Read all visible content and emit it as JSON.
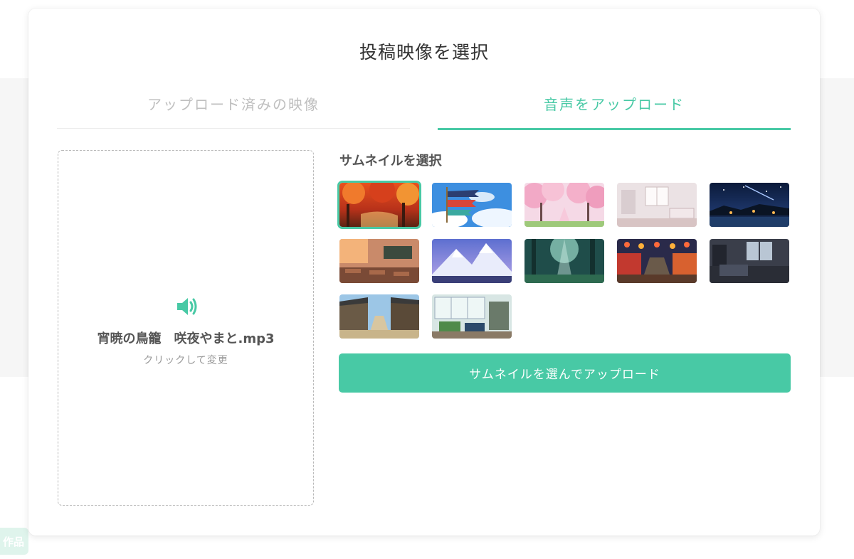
{
  "side_badge": {
    "label": "作品"
  },
  "modal": {
    "title": "投稿映像を選択",
    "tabs": [
      {
        "label": "アップロード済みの映像",
        "active": false
      },
      {
        "label": "音声をアップロード",
        "active": true
      }
    ],
    "dropzone": {
      "icon": "speaker-icon",
      "file_name": "宵暁の鳥籠　咲夜やまと.mp3",
      "hint": "クリックして変更"
    },
    "thumbnails": {
      "heading": "サムネイルを選択",
      "items": [
        {
          "name": "autumn-forest",
          "selected": true
        },
        {
          "name": "koinobori-sky",
          "selected": false
        },
        {
          "name": "cherry-blossom-path",
          "selected": false
        },
        {
          "name": "bright-bedroom",
          "selected": false
        },
        {
          "name": "night-lake",
          "selected": false
        },
        {
          "name": "sunset-classroom",
          "selected": false
        },
        {
          "name": "snow-mountain",
          "selected": false
        },
        {
          "name": "forest-light",
          "selected": false
        },
        {
          "name": "festival-street",
          "selected": false
        },
        {
          "name": "dark-room",
          "selected": false
        },
        {
          "name": "old-town-street",
          "selected": false
        },
        {
          "name": "greenhouse-cafe",
          "selected": false
        }
      ]
    },
    "upload_button": {
      "label": "サムネイルを選んでアップロード"
    }
  },
  "colors": {
    "accent": "#48c9a5",
    "inactive_tab": "#bfbfbf",
    "text": "#333333"
  }
}
